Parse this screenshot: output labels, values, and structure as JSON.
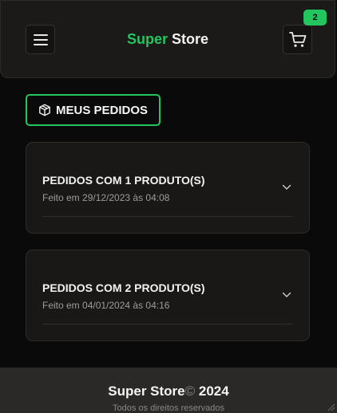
{
  "header": {
    "brand_primary": "Super",
    "brand_secondary": "Store",
    "menu_icon": "hamburger-menu-icon",
    "cart_icon": "shopping-cart-icon",
    "cart_count": "2"
  },
  "page": {
    "title": "MEUS PEDIDOS",
    "title_icon": "package-icon"
  },
  "orders": [
    {
      "title": "PEDIDOS COM 1 PRODUTO(S)",
      "date": "Feito em 29/12/2023 às 04:08"
    },
    {
      "title": "PEDIDOS COM 2 PRODUTO(S)",
      "date": "Feito em 04/01/2024 às 04:16"
    }
  ],
  "footer": {
    "brand": "Super Store",
    "copyright_symbol": "©",
    "year": "2024",
    "rights": "Todos os direitos reservados"
  },
  "colors": {
    "accent": "#22c55e",
    "background": "#0b0a0a",
    "card": "#1a1817",
    "footer": "#2b2828"
  }
}
